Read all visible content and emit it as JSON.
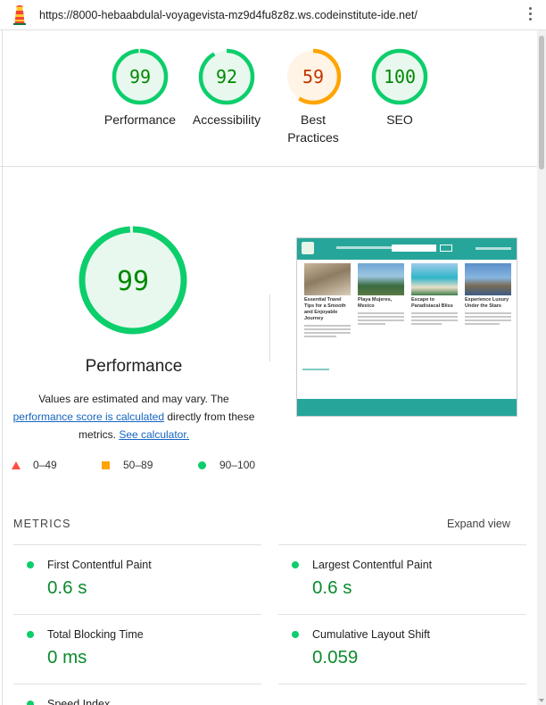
{
  "browser": {
    "url": "https://8000-hebaabdulal-voyagevista-mz9d4fu8z8z.ws.codeinstitute-ide.net/",
    "logo_icon": "lighthouse-icon",
    "menu_icon": "kebab-menu-icon"
  },
  "colors": {
    "pass": "#0cce6b",
    "pass_text": "#008800",
    "average": "#ffa400",
    "average_text": "#c33300",
    "fail": "#ff4e42",
    "link": "#1565c0"
  },
  "categories": [
    {
      "label": "Performance",
      "score": 99,
      "rating": "pass"
    },
    {
      "label": "Accessibility",
      "score": 92,
      "rating": "pass"
    },
    {
      "label": "Best Practices",
      "label_line1": "Best",
      "label_line2": "Practices",
      "score": 59,
      "rating": "average"
    },
    {
      "label": "SEO",
      "score": 100,
      "rating": "pass"
    }
  ],
  "performance": {
    "score": 99,
    "title": "Performance",
    "note_prefix": "Values are estimated and may vary. The ",
    "note_link": "performance score is calculated",
    "note_middle": " directly from these metrics. ",
    "note_calc_link": "See calculator."
  },
  "legend": [
    {
      "range": "0–49",
      "icon": "triangle-icon"
    },
    {
      "range": "50–89",
      "icon": "square-icon"
    },
    {
      "range": "90–100",
      "icon": "circle-icon"
    }
  ],
  "screenshot": {
    "cards": [
      {
        "title": "Essential Travel Tips for a Smooth and Enjoyable Journey"
      },
      {
        "title": "Playa Mujeres, Mexico"
      },
      {
        "title": "Escape to Paradisiacal Bliss"
      },
      {
        "title": "Experience Luxury Under the Stars"
      }
    ]
  },
  "metrics": {
    "heading": "METRICS",
    "expand_label": "Expand view",
    "items": [
      {
        "title": "First Contentful Paint",
        "value": "0.6 s"
      },
      {
        "title": "Largest Contentful Paint",
        "value": "0.6 s"
      },
      {
        "title": "Total Blocking Time",
        "value": "0 ms"
      },
      {
        "title": "Cumulative Layout Shift",
        "value": "0.059"
      },
      {
        "title": "Speed Index",
        "value": ""
      }
    ]
  }
}
